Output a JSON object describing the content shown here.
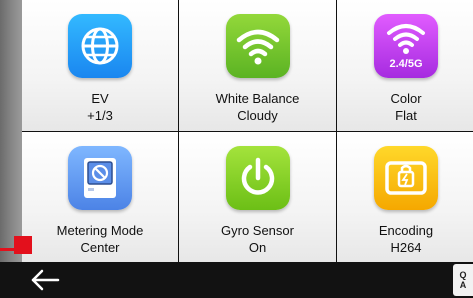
{
  "tiles": [
    {
      "label": "EV",
      "value": "+1/3",
      "icon": "globe-icon",
      "color": "#1a86f0"
    },
    {
      "label": "White Balance",
      "value": "Cloudy",
      "icon": "wifi-icon",
      "color": "#5bb323"
    },
    {
      "label": "Color",
      "value": "Flat",
      "icon": "wifi-icon",
      "badge": "2.4/5G",
      "color": "#a62be0"
    },
    {
      "label": "Metering Mode",
      "value": "Center",
      "icon": "device-icon",
      "color": "#4c83e6"
    },
    {
      "label": "Gyro Sensor",
      "value": "On",
      "icon": "power-icon",
      "color": "#6cbf16"
    },
    {
      "label": "Encoding",
      "value": "H264",
      "icon": "battery-card-icon",
      "color": "#f5a800"
    }
  ],
  "bottom_bar": {
    "back_icon": "arrow-left-icon",
    "right_icon_top": "Q",
    "right_icon_bottom": "A"
  }
}
